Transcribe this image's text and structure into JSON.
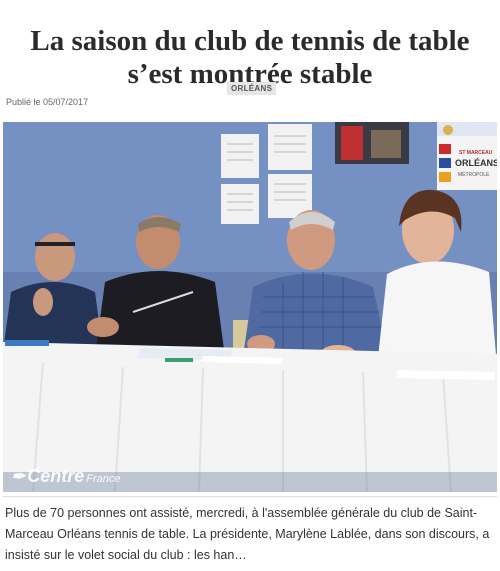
{
  "article": {
    "title": "La saison du club de tennis de table s’est montrée stable",
    "category": "ORLÉANS",
    "published": "Publié le 05/07/2017",
    "excerpt": "Plus de 70 personnes ont assisté, mercredi, à l'assemblée générale du club de Saint-Marceau Orléans tennis de table. La présidente, Marylène Lablée, dans son discours, a insisté sur le volet social du club : les han…"
  },
  "photo": {
    "watermark_logo": "✒",
    "watermark_centre": "Centre",
    "watermark_france": "France",
    "poster_text_club": "ST MARCEAU",
    "poster_text_city": "ORLÉANS",
    "poster_text_metro": "MÉTROPOLE"
  },
  "colors": {
    "wall": "#6f88bb",
    "table_cloth": "#f4f4f4",
    "headline": "#2b2b2b"
  }
}
